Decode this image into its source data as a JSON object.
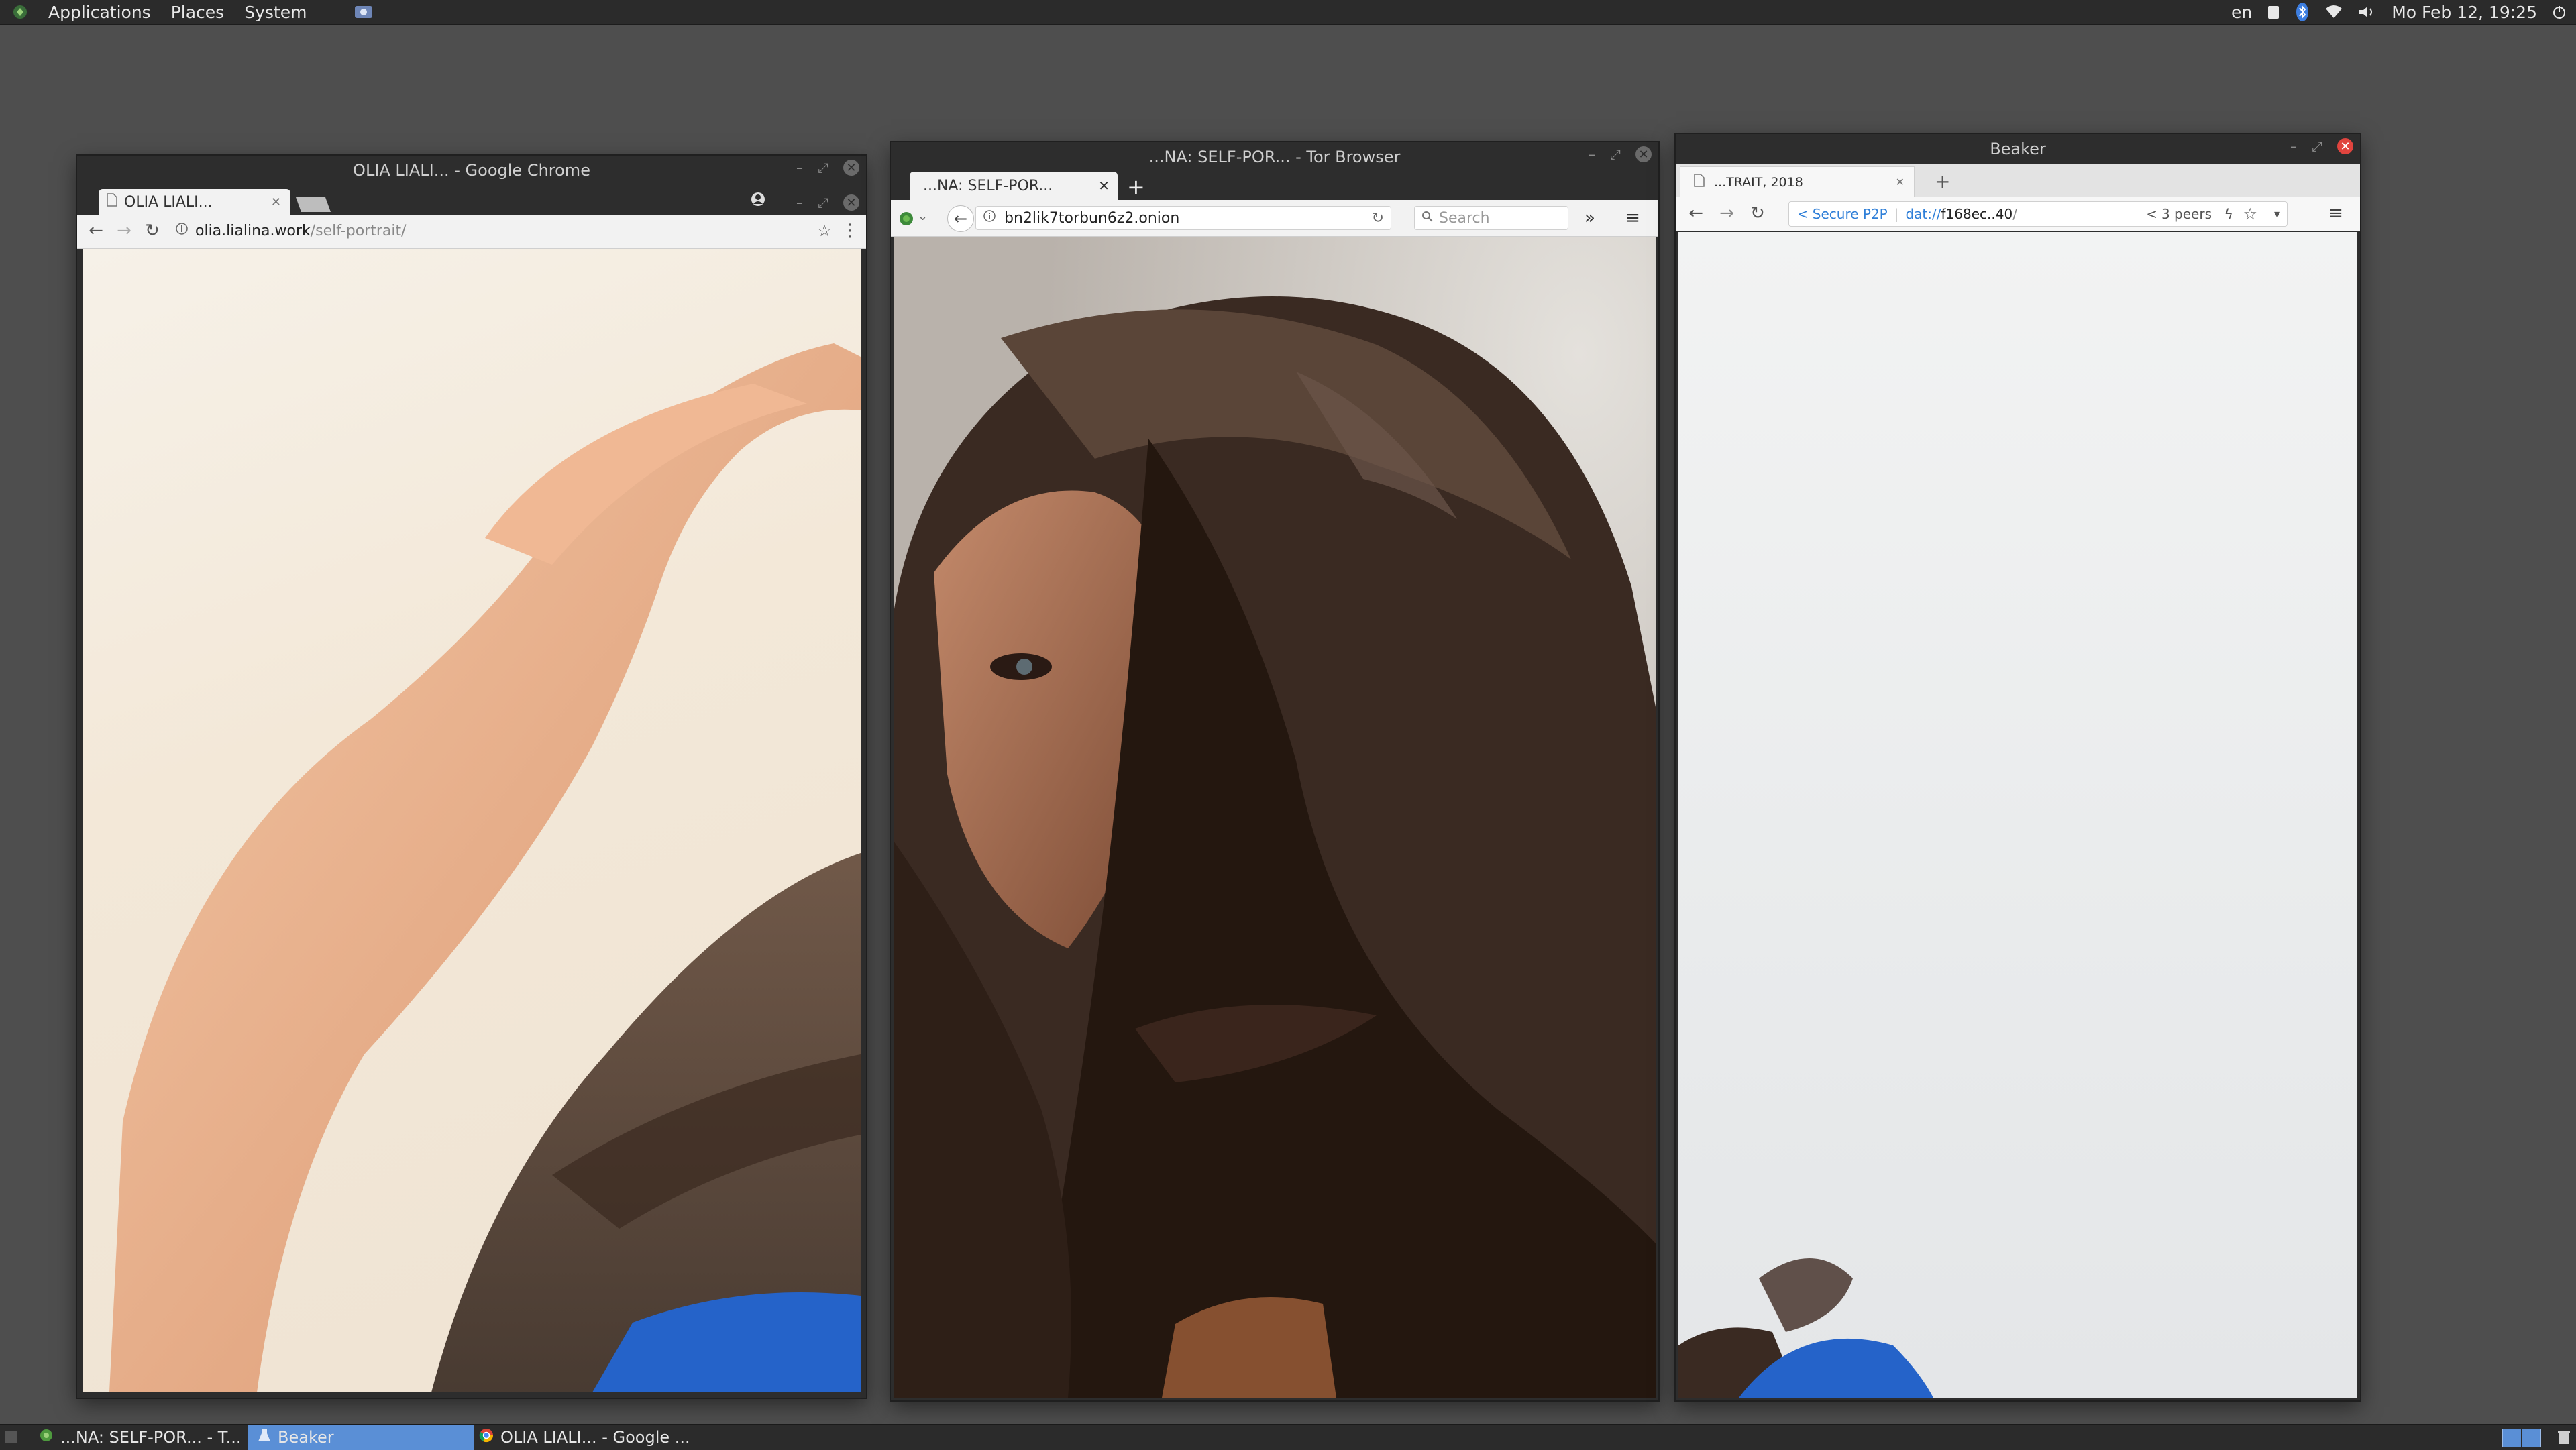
{
  "topbar": {
    "menu": [
      "Applications",
      "Places",
      "System"
    ],
    "lang": "en",
    "clock": "Mo Feb 12, 19:25"
  },
  "chrome": {
    "window_title": "OLIA LIALI... - Google Chrome",
    "tab_label": "OLIA LIALI...",
    "url_domain": "olia.lialina.work",
    "url_path": "/self-portrait/"
  },
  "tor": {
    "window_title": "...NA: SELF-POR... - Tor Browser",
    "tab_label": "...NA: SELF-POR...",
    "url": "bn2lik7torbun6z2.onion",
    "search_placeholder": "Search"
  },
  "beaker": {
    "window_title": "Beaker",
    "tab_label": "...TRAIT, 2018",
    "secure_label": "Secure P2P",
    "url_scheme": "dat://",
    "url_host": "f168ec..40",
    "url_slash": "/",
    "peers": "3 peers"
  },
  "taskbar": {
    "items": [
      {
        "label": "...NA: SELF-POR... - T...",
        "active": false
      },
      {
        "label": "Beaker",
        "active": true
      },
      {
        "label": "OLIA LIALI... - Google ...",
        "active": false
      }
    ]
  },
  "colors": {
    "panel": "#2b2b2b",
    "desktop": "#4e4e4e",
    "taskbar_active": "#5a8fd6",
    "beaker_link": "#2f7fd8",
    "close_red": "#e0443e"
  },
  "icons": [
    "menu-logo-icon",
    "screenshot-app-icon",
    "clipboard-icon",
    "bluetooth-icon",
    "wifi-icon",
    "volume-icon",
    "power-icon",
    "page-icon",
    "close-icon",
    "back-icon",
    "forward-icon",
    "reload-icon",
    "info-icon",
    "star-icon",
    "more-icon",
    "onion-icon",
    "search-icon",
    "overflow-icon",
    "hamburger-icon",
    "share-icon",
    "bolt-icon",
    "chevron-down-icon",
    "show-desktop-icon",
    "workspace-icon",
    "trash-icon"
  ]
}
